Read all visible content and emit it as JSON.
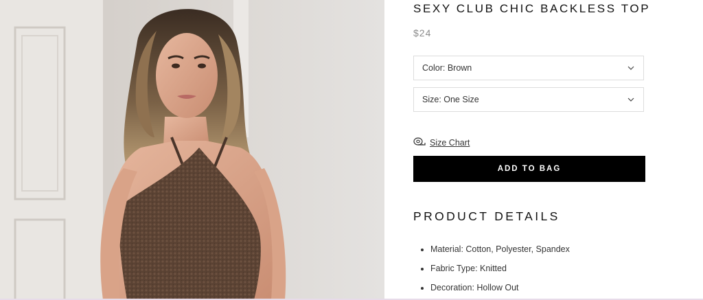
{
  "product": {
    "title": "SEXY CLUB CHIC BACKLESS TOP",
    "price": "$24",
    "image_alt": "Model wearing brown knitted halter backless top"
  },
  "options": {
    "color_label": "Color: Brown",
    "size_label": "Size: One Size"
  },
  "size_chart": {
    "label": "Size Chart",
    "icon": "tape-measure-icon"
  },
  "cart": {
    "add_label": "ADD TO BAG"
  },
  "details": {
    "heading": "PRODUCT DETAILS",
    "items": [
      "Material: Cotton, Polyester, Spandex",
      "Fabric Type: Knitted",
      "Decoration: Hollow Out"
    ]
  },
  "colors": {
    "button_bg": "#000000",
    "border": "#dcdcdc",
    "price": "#8a8a8a",
    "top_fabric": "#5a4233"
  }
}
